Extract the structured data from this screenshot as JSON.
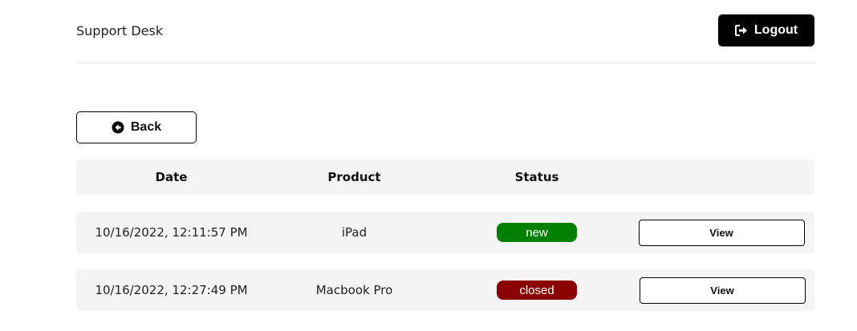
{
  "header": {
    "brand": "Support Desk",
    "logout_label": "Logout",
    "logout_icon": "sign-out-icon"
  },
  "back": {
    "label": "Back",
    "icon": "arrow-circle-left-icon"
  },
  "table": {
    "columns": [
      "Date",
      "Product",
      "Status",
      ""
    ],
    "rows": [
      {
        "date": "10/16/2022, 12:11:57 PM",
        "product": "iPad",
        "status": "new",
        "status_color": "#008000",
        "action_label": "View"
      },
      {
        "date": "10/16/2022, 12:27:49 PM",
        "product": "Macbook Pro",
        "status": "closed",
        "status_color": "#8b0000",
        "action_label": "View"
      }
    ]
  },
  "colors": {
    "primary": "#000000",
    "row_background": "#f4f4f4",
    "status_new": "#008000",
    "status_closed": "#8b0000"
  }
}
